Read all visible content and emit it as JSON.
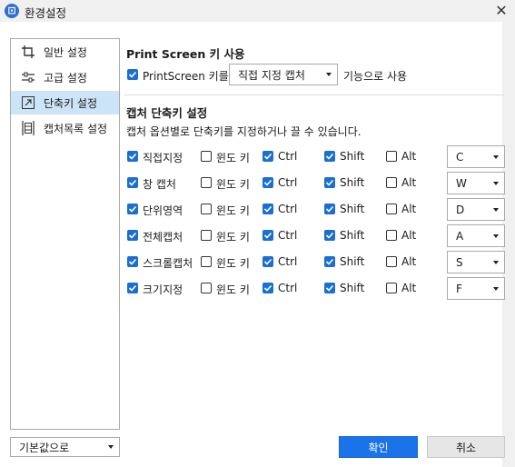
{
  "window": {
    "title": "환경설정",
    "app_icon_glyph": "⊡",
    "close_glyph": "✕"
  },
  "sidebar": {
    "items": [
      {
        "label": "일반 설정",
        "icon": "crop-icon",
        "active": false
      },
      {
        "label": "고급 설정",
        "icon": "sliders-icon",
        "active": false
      },
      {
        "label": "단축키 설정",
        "icon": "shortcut-arrow-icon",
        "active": true
      },
      {
        "label": "캡처목록 설정",
        "icon": "capture-list-icon",
        "active": false
      }
    ]
  },
  "print_screen": {
    "section_title": "Print Screen 키 사용",
    "checkbox_label": "PrintScreen 키를",
    "checked": true,
    "action_value": "직접 지정 캡처",
    "suffix_label": "기능으로 사용"
  },
  "shortcuts": {
    "section_title": "캡처 단축키 설정",
    "description": "캡처 옵션별로 단축키를 지정하거나 끌 수 있습니다.",
    "modifier_labels": {
      "win": "윈도 키",
      "ctrl": "Ctrl",
      "shift": "Shift",
      "alt": "Alt"
    },
    "rows": [
      {
        "label": "직접지정",
        "enabled": true,
        "win": false,
        "ctrl": true,
        "shift": true,
        "alt": false,
        "key": "C"
      },
      {
        "label": "창 캡처",
        "enabled": true,
        "win": false,
        "ctrl": true,
        "shift": true,
        "alt": false,
        "key": "W"
      },
      {
        "label": "단위영역",
        "enabled": true,
        "win": false,
        "ctrl": true,
        "shift": true,
        "alt": false,
        "key": "D"
      },
      {
        "label": "전체캡처",
        "enabled": true,
        "win": false,
        "ctrl": true,
        "shift": true,
        "alt": false,
        "key": "A"
      },
      {
        "label": "스크롤캡처",
        "enabled": true,
        "win": false,
        "ctrl": true,
        "shift": true,
        "alt": false,
        "key": "S"
      },
      {
        "label": "크기지정",
        "enabled": true,
        "win": false,
        "ctrl": true,
        "shift": true,
        "alt": false,
        "key": "F"
      }
    ]
  },
  "footer": {
    "defaults_value": "기본값으로",
    "ok_label": "확인",
    "cancel_label": "취소"
  },
  "colors": {
    "accent": "#1a73e8",
    "checkbox_on": "#1a6fd1",
    "sidebar_active": "#cce4f7"
  }
}
